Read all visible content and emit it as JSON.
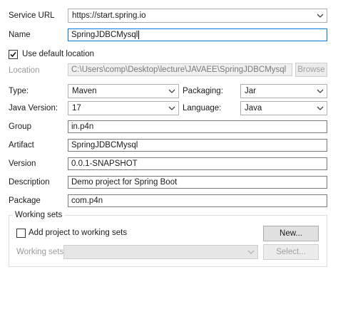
{
  "service_url": {
    "label": "Service URL",
    "value": "https://start.spring.io"
  },
  "name": {
    "label": "Name",
    "value": "SpringJDBCMysql"
  },
  "use_default_location": {
    "label": "Use default location",
    "checked": true
  },
  "location": {
    "label": "Location",
    "value": "C:\\Users\\comp\\Desktop\\lecture\\JAVAEE\\SpringJDBCMysql",
    "browse_label": "Browse"
  },
  "type": {
    "label": "Type:",
    "value": "Maven"
  },
  "packaging": {
    "label": "Packaging:",
    "value": "Jar"
  },
  "java_version": {
    "label": "Java Version:",
    "value": "17"
  },
  "language": {
    "label": "Language:",
    "value": "Java"
  },
  "group": {
    "label": "Group",
    "value": "in.p4n"
  },
  "artifact": {
    "label": "Artifact",
    "value": "SpringJDBCMysql"
  },
  "version": {
    "label": "Version",
    "value": "0.0.1-SNAPSHOT"
  },
  "description": {
    "label": "Description",
    "value": "Demo project for Spring Boot"
  },
  "package": {
    "label": "Package",
    "value": "com.p4n"
  },
  "working_sets": {
    "title": "Working sets",
    "add_label": "Add project to working sets",
    "add_checked": false,
    "new_label": "New...",
    "sets_label": "Working sets:",
    "sets_value": "",
    "select_label": "Select..."
  },
  "colors": {
    "focus": "#0078d7",
    "check": "#1a1a1a"
  },
  "icons": {
    "dropdown": "chevron-down-icon",
    "check": "checkmark-icon"
  }
}
